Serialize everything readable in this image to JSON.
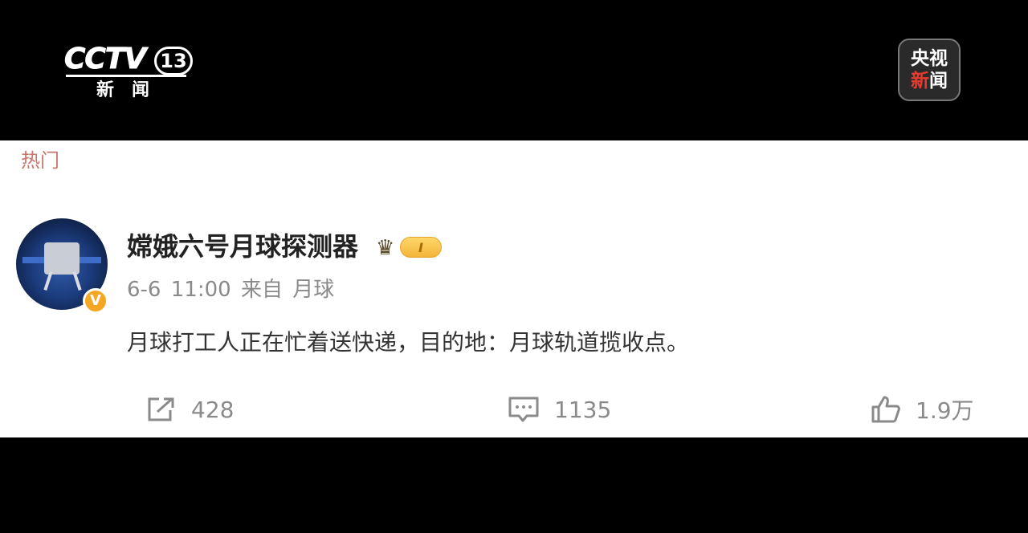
{
  "broadcast": {
    "channel_logo": {
      "letters": "CCTV",
      "number": "13",
      "subtitle": "新闻"
    },
    "news_badge": {
      "line1": "央视",
      "line2_part1": "新",
      "line2_part2": "闻"
    }
  },
  "tab": {
    "label": "热门"
  },
  "post": {
    "author": "嫦娥六号月球探测器",
    "level_badge": "I",
    "time": "6-6 11:00",
    "source": "来自 月球",
    "text": "月球打工人正在忙着送快递，目的地：月球轨道揽收点。",
    "actions": {
      "share_count": "428",
      "comment_count": "1135",
      "like_count": "1.9万"
    }
  },
  "icons": [
    "crown-icon",
    "verified-icon",
    "share-icon",
    "comment-icon",
    "like-icon"
  ],
  "colors": {
    "tab_text": "#c8766c",
    "verified": "#f5a623",
    "level_badge": "#f2b53a",
    "muted_text": "#8a8a8a"
  }
}
